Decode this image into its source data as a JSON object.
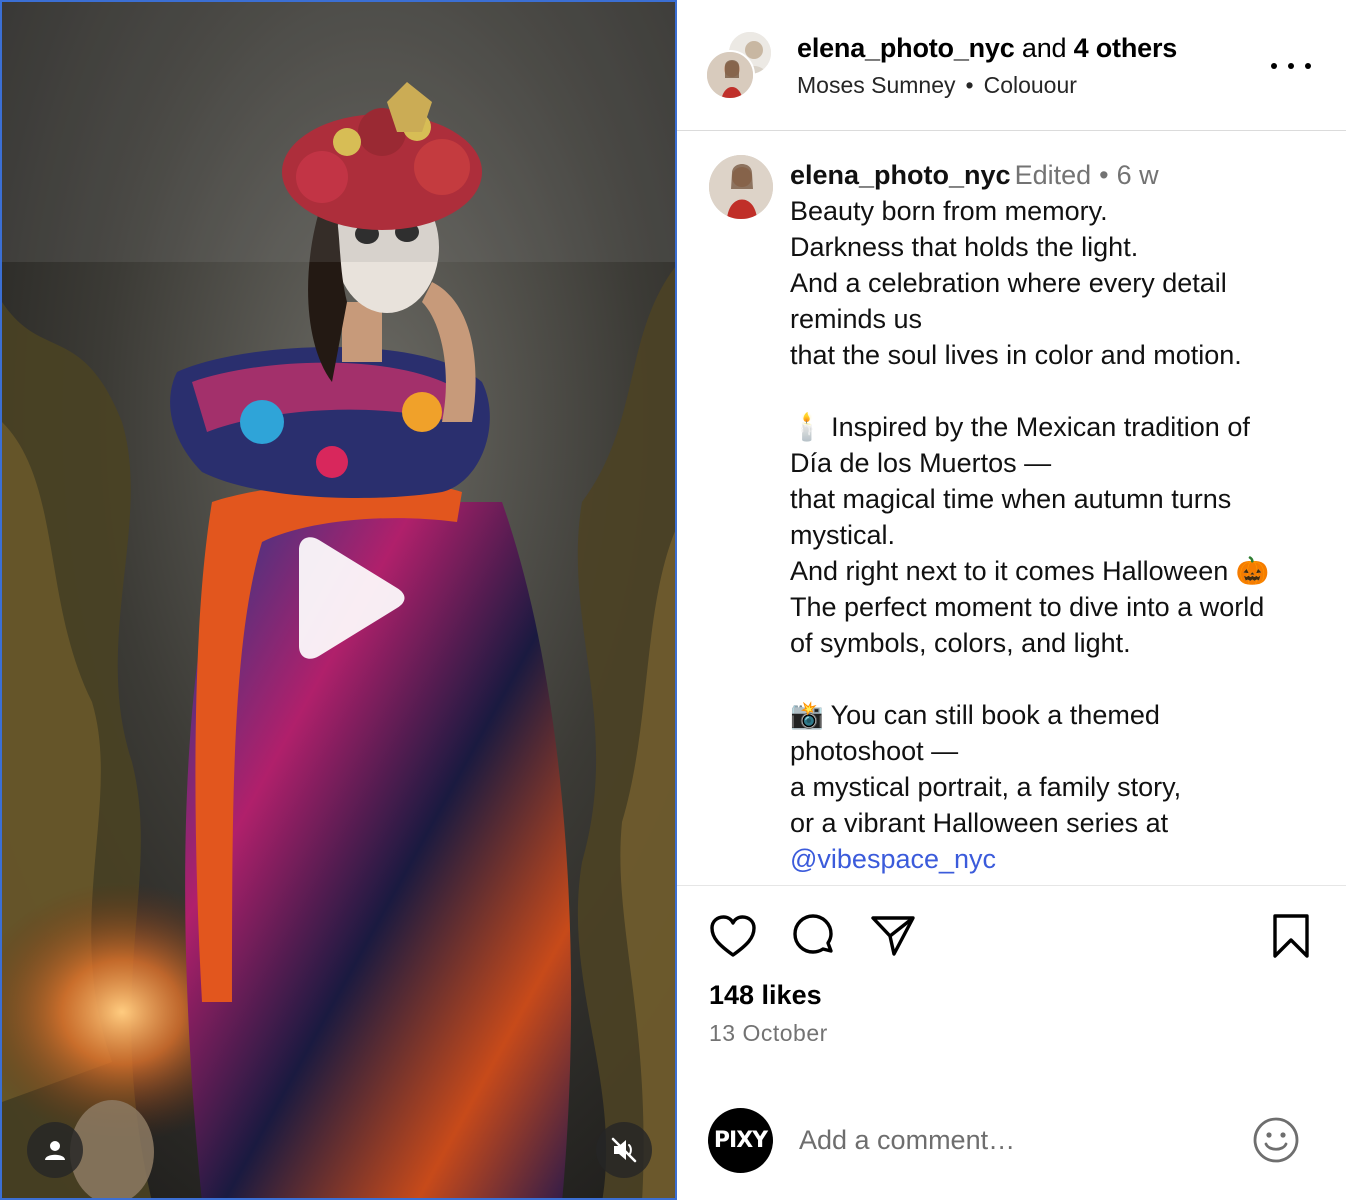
{
  "post": {
    "header": {
      "username": "elena_photo_nyc",
      "and_text": "and",
      "others": "4 others",
      "artist": "Moses Sumney",
      "separator": "•",
      "track": "Colouour"
    },
    "caption": {
      "username": "elena_photo_nyc",
      "edited": "Edited",
      "dot": "•",
      "time": "6 w",
      "lines": [
        "Beauty born from memory.",
        "Darkness that holds the light.",
        "And a celebration where every detail",
        "reminds us",
        "that the soul lives in color and motion.",
        "",
        "🕯️ Inspired by the Mexican tradition of",
        "Día de los Muertos —",
        "that magical time when autumn turns",
        "mystical.",
        "And right next to it comes Halloween 🎃",
        "The perfect moment to dive into a world",
        "of symbols, colors, and light.",
        "",
        "📸 You can still book a themed",
        "photoshoot —",
        "a mystical portrait, a family story,",
        "or a vibrant Halloween series at"
      ],
      "mention": "@vibespace_nyc"
    },
    "likes": "148 likes",
    "date": "13 October",
    "comment": {
      "avatar_text": "PIXY",
      "placeholder": "Add a comment…"
    }
  },
  "icons": {
    "like": "heart-icon",
    "comment": "comment-bubble-icon",
    "share": "paper-plane-icon",
    "save": "bookmark-icon",
    "more": "more-horizontal-icon",
    "play": "play-icon",
    "tag": "user-tag-icon",
    "mute": "speaker-muted-icon",
    "emoji": "smiley-icon"
  },
  "colors": {
    "link": "#3b5bdb",
    "muted_text": "#737373",
    "divider": "#dbdbdb"
  }
}
